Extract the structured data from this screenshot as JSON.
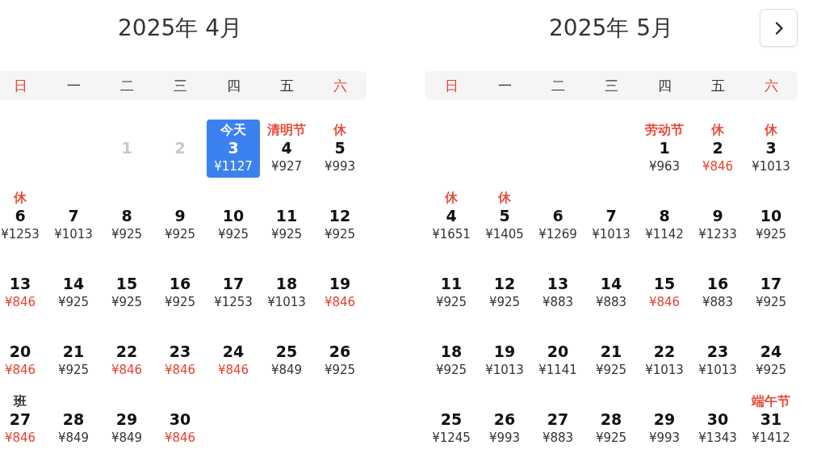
{
  "months": [
    {
      "title": "2025年 4月",
      "weekdays": [
        {
          "label": "日",
          "weekend": true
        },
        {
          "label": "一",
          "weekend": false
        },
        {
          "label": "二",
          "weekend": false
        },
        {
          "label": "三",
          "weekend": false
        },
        {
          "label": "四",
          "weekend": false
        },
        {
          "label": "五",
          "weekend": false
        },
        {
          "label": "六",
          "weekend": true
        }
      ],
      "weeks": [
        [
          {
            "kind": "blank"
          },
          {
            "kind": "blank"
          },
          {
            "kind": "day",
            "day": "1",
            "disabled": true,
            "selected": false
          },
          {
            "kind": "day",
            "day": "2",
            "disabled": true,
            "selected": false
          },
          {
            "kind": "day",
            "day": "3",
            "label": {
              "text": "今天",
              "color": "#ffffff"
            },
            "price": "¥1127",
            "low": false,
            "selected": true,
            "disabled": false
          },
          {
            "kind": "day",
            "day": "4",
            "label": {
              "text": "清明节",
              "color": "#e8412f"
            },
            "price": "¥927",
            "low": false,
            "selected": false,
            "disabled": false
          },
          {
            "kind": "day",
            "day": "5",
            "label": {
              "text": "休",
              "color": "#e8412f"
            },
            "price": "¥993",
            "low": false,
            "selected": false,
            "disabled": false
          }
        ],
        [
          {
            "kind": "day",
            "day": "6",
            "label": {
              "text": "休",
              "color": "#e8412f"
            },
            "price": "¥1253",
            "low": false,
            "selected": false,
            "disabled": false
          },
          {
            "kind": "day",
            "day": "7",
            "price": "¥1013",
            "low": false,
            "selected": false,
            "disabled": false
          },
          {
            "kind": "day",
            "day": "8",
            "price": "¥925",
            "low": false,
            "selected": false,
            "disabled": false
          },
          {
            "kind": "day",
            "day": "9",
            "price": "¥925",
            "low": false,
            "selected": false,
            "disabled": false
          },
          {
            "kind": "day",
            "day": "10",
            "price": "¥925",
            "low": false,
            "selected": false,
            "disabled": false
          },
          {
            "kind": "day",
            "day": "11",
            "price": "¥925",
            "low": false,
            "selected": false,
            "disabled": false
          },
          {
            "kind": "day",
            "day": "12",
            "price": "¥925",
            "low": false,
            "selected": false,
            "disabled": false
          }
        ],
        [
          {
            "kind": "day",
            "day": "13",
            "price": "¥846",
            "low": true,
            "selected": false,
            "disabled": false
          },
          {
            "kind": "day",
            "day": "14",
            "price": "¥925",
            "low": false,
            "selected": false,
            "disabled": false
          },
          {
            "kind": "day",
            "day": "15",
            "price": "¥925",
            "low": false,
            "selected": false,
            "disabled": false
          },
          {
            "kind": "day",
            "day": "16",
            "price": "¥925",
            "low": false,
            "selected": false,
            "disabled": false
          },
          {
            "kind": "day",
            "day": "17",
            "price": "¥1253",
            "low": false,
            "selected": false,
            "disabled": false
          },
          {
            "kind": "day",
            "day": "18",
            "price": "¥1013",
            "low": false,
            "selected": false,
            "disabled": false
          },
          {
            "kind": "day",
            "day": "19",
            "price": "¥846",
            "low": true,
            "selected": false,
            "disabled": false
          }
        ],
        [
          {
            "kind": "day",
            "day": "20",
            "price": "¥846",
            "low": true,
            "selected": false,
            "disabled": false
          },
          {
            "kind": "day",
            "day": "21",
            "price": "¥925",
            "low": false,
            "selected": false,
            "disabled": false
          },
          {
            "kind": "day",
            "day": "22",
            "price": "¥846",
            "low": true,
            "selected": false,
            "disabled": false
          },
          {
            "kind": "day",
            "day": "23",
            "price": "¥846",
            "low": true,
            "selected": false,
            "disabled": false
          },
          {
            "kind": "day",
            "day": "24",
            "price": "¥846",
            "low": true,
            "selected": false,
            "disabled": false
          },
          {
            "kind": "day",
            "day": "25",
            "price": "¥849",
            "low": false,
            "selected": false,
            "disabled": false
          },
          {
            "kind": "day",
            "day": "26",
            "price": "¥925",
            "low": false,
            "selected": false,
            "disabled": false
          }
        ],
        [
          {
            "kind": "day",
            "day": "27",
            "label": {
              "text": "班",
              "color": "#222222"
            },
            "price": "¥846",
            "low": true,
            "selected": false,
            "disabled": false
          },
          {
            "kind": "day",
            "day": "28",
            "price": "¥849",
            "low": false,
            "selected": false,
            "disabled": false
          },
          {
            "kind": "day",
            "day": "29",
            "price": "¥849",
            "low": false,
            "selected": false,
            "disabled": false
          },
          {
            "kind": "day",
            "day": "30",
            "price": "¥846",
            "low": true,
            "selected": false,
            "disabled": false
          }
        ]
      ]
    },
    {
      "title": "2025年 5月",
      "next_button": true,
      "weekdays": [
        {
          "label": "日",
          "weekend": true
        },
        {
          "label": "一",
          "weekend": false
        },
        {
          "label": "二",
          "weekend": false
        },
        {
          "label": "三",
          "weekend": false
        },
        {
          "label": "四",
          "weekend": false
        },
        {
          "label": "五",
          "weekend": false
        },
        {
          "label": "六",
          "weekend": true
        }
      ],
      "weeks": [
        [
          {
            "kind": "blank"
          },
          {
            "kind": "blank"
          },
          {
            "kind": "blank"
          },
          {
            "kind": "blank"
          },
          {
            "kind": "day",
            "day": "1",
            "label": {
              "text": "劳动节",
              "color": "#e8412f"
            },
            "price": "¥963",
            "low": false,
            "selected": false,
            "disabled": false
          },
          {
            "kind": "day",
            "day": "2",
            "label": {
              "text": "休",
              "color": "#e8412f"
            },
            "price": "¥846",
            "low": true,
            "selected": false,
            "disabled": false
          },
          {
            "kind": "day",
            "day": "3",
            "label": {
              "text": "休",
              "color": "#e8412f"
            },
            "price": "¥1013",
            "low": false,
            "selected": false,
            "disabled": false
          }
        ],
        [
          {
            "kind": "day",
            "day": "4",
            "label": {
              "text": "休",
              "color": "#e8412f"
            },
            "price": "¥1651",
            "low": false,
            "selected": false,
            "disabled": false
          },
          {
            "kind": "day",
            "day": "5",
            "label": {
              "text": "休",
              "color": "#e8412f"
            },
            "price": "¥1405",
            "low": false,
            "selected": false,
            "disabled": false
          },
          {
            "kind": "day",
            "day": "6",
            "price": "¥1269",
            "low": false,
            "selected": false,
            "disabled": false
          },
          {
            "kind": "day",
            "day": "7",
            "price": "¥1013",
            "low": false,
            "selected": false,
            "disabled": false
          },
          {
            "kind": "day",
            "day": "8",
            "price": "¥1142",
            "low": false,
            "selected": false,
            "disabled": false
          },
          {
            "kind": "day",
            "day": "9",
            "price": "¥1233",
            "low": false,
            "selected": false,
            "disabled": false
          },
          {
            "kind": "day",
            "day": "10",
            "price": "¥925",
            "low": false,
            "selected": false,
            "disabled": false
          }
        ],
        [
          {
            "kind": "day",
            "day": "11",
            "price": "¥925",
            "low": false,
            "selected": false,
            "disabled": false
          },
          {
            "kind": "day",
            "day": "12",
            "price": "¥925",
            "low": false,
            "selected": false,
            "disabled": false
          },
          {
            "kind": "day",
            "day": "13",
            "price": "¥883",
            "low": false,
            "selected": false,
            "disabled": false
          },
          {
            "kind": "day",
            "day": "14",
            "price": "¥883",
            "low": false,
            "selected": false,
            "disabled": false
          },
          {
            "kind": "day",
            "day": "15",
            "price": "¥846",
            "low": true,
            "selected": false,
            "disabled": false
          },
          {
            "kind": "day",
            "day": "16",
            "price": "¥883",
            "low": false,
            "selected": false,
            "disabled": false
          },
          {
            "kind": "day",
            "day": "17",
            "price": "¥925",
            "low": false,
            "selected": false,
            "disabled": false
          }
        ],
        [
          {
            "kind": "day",
            "day": "18",
            "price": "¥925",
            "low": false,
            "selected": false,
            "disabled": false
          },
          {
            "kind": "day",
            "day": "19",
            "price": "¥1013",
            "low": false,
            "selected": false,
            "disabled": false
          },
          {
            "kind": "day",
            "day": "20",
            "price": "¥1141",
            "low": false,
            "selected": false,
            "disabled": false
          },
          {
            "kind": "day",
            "day": "21",
            "price": "¥925",
            "low": false,
            "selected": false,
            "disabled": false
          },
          {
            "kind": "day",
            "day": "22",
            "price": "¥1013",
            "low": false,
            "selected": false,
            "disabled": false
          },
          {
            "kind": "day",
            "day": "23",
            "price": "¥1013",
            "low": false,
            "selected": false,
            "disabled": false
          },
          {
            "kind": "day",
            "day": "24",
            "price": "¥925",
            "low": false,
            "selected": false,
            "disabled": false
          }
        ],
        [
          {
            "kind": "day",
            "day": "25",
            "price": "¥1245",
            "low": false,
            "selected": false,
            "disabled": false
          },
          {
            "kind": "day",
            "day": "26",
            "price": "¥993",
            "low": false,
            "selected": false,
            "disabled": false
          },
          {
            "kind": "day",
            "day": "27",
            "price": "¥883",
            "low": false,
            "selected": false,
            "disabled": false
          },
          {
            "kind": "day",
            "day": "28",
            "price": "¥925",
            "low": false,
            "selected": false,
            "disabled": false
          },
          {
            "kind": "day",
            "day": "29",
            "price": "¥993",
            "low": false,
            "selected": false,
            "disabled": false
          },
          {
            "kind": "day",
            "day": "30",
            "price": "¥1343",
            "low": false,
            "selected": false,
            "disabled": false
          },
          {
            "kind": "day",
            "day": "31",
            "label": {
              "text": "端午节",
              "color": "#e8412f"
            },
            "price": "¥1412",
            "low": false,
            "selected": false,
            "disabled": false
          }
        ]
      ]
    }
  ]
}
